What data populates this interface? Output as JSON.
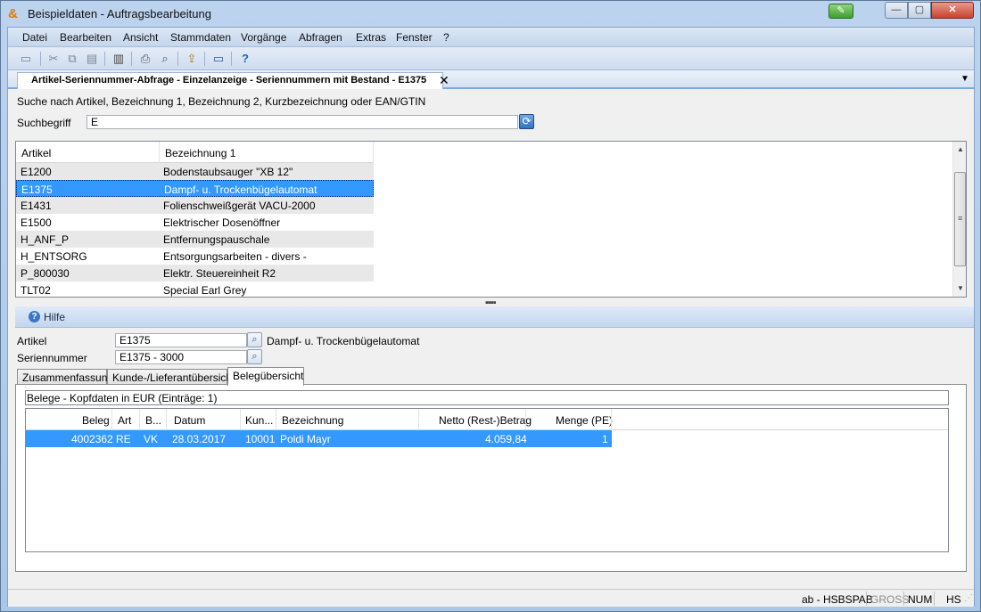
{
  "window": {
    "title": "Beispieldaten - Auftragsbearbeitung",
    "app_icon": "app-logo-icon"
  },
  "menubar": {
    "items": [
      "Datei",
      "Bearbeiten",
      "Ansicht",
      "Stammdaten",
      "Vorgänge",
      "Abfragen",
      "Extras",
      "Fenster",
      "?"
    ]
  },
  "toolbar": {
    "icons": [
      "open-folder-icon",
      "cut-icon",
      "copy-icon",
      "paste-icon",
      "list-icon",
      "print-icon",
      "print-preview-icon",
      "export-icon",
      "window-icon",
      "help-icon"
    ]
  },
  "document_tab": {
    "title": "Artikel-Seriennummer-Abfrage - Einzelanzeige - Seriennummern mit Bestand - E1375",
    "close": "✕"
  },
  "search": {
    "description": "Suche nach Artikel, Bezeichnung 1, Bezeichnung 2, Kurzbezeichnung oder EAN/GTIN",
    "label": "Suchbegriff",
    "value": "E"
  },
  "article_grid": {
    "columns": [
      "Artikel",
      "Bezeichnung 1"
    ],
    "rows": [
      {
        "artikel": "E1200",
        "bezeichnung": "Bodenstaubsauger \"XB 12\""
      },
      {
        "artikel": "E1375",
        "bezeichnung": "Dampf- u. Trockenbügelautomat"
      },
      {
        "artikel": "E1431",
        "bezeichnung": "Folienschweißgerät VACU-2000"
      },
      {
        "artikel": "E1500",
        "bezeichnung": "Elektrischer Dosenöffner"
      },
      {
        "artikel": "H_ANF_P",
        "bezeichnung": "Entfernungspauschale"
      },
      {
        "artikel": "H_ENTSORG",
        "bezeichnung": "Entsorgungsarbeiten - divers -"
      },
      {
        "artikel": "P_800030",
        "bezeichnung": "Elektr. Steuereinheit R2"
      },
      {
        "artikel": "TLT02",
        "bezeichnung": "Special Earl Grey"
      }
    ],
    "selected_index": 1
  },
  "help": {
    "label": "Hilfe"
  },
  "detail": {
    "artikel_label": "Artikel",
    "artikel_value": "E1375",
    "artikel_desc": "Dampf- u. Trockenbügelautomat",
    "serien_label": "Seriennummer",
    "serien_value": "E1375 - 3000"
  },
  "subtabs": {
    "items": [
      "Zusammenfassung",
      "Kunde-/Lieferantübersicht",
      "Belegübersicht"
    ],
    "active_index": 2
  },
  "belege": {
    "caption": "Belege - Kopfdaten in EUR (Einträge: 1)",
    "columns": [
      "Beleg",
      "Art",
      "B...",
      "Datum",
      "Kun...",
      "Bezeichnung",
      "Netto (Rest-)Betrag",
      "Menge (PE)"
    ],
    "rows": [
      {
        "beleg": "4002362",
        "art": "RE",
        "b": "VK",
        "datum": "28.03.2017",
        "kunde": "10001",
        "bezeichnung": "Poldi Mayr",
        "netto": "4.059,84",
        "menge": "1"
      }
    ]
  },
  "statusbar": {
    "user": "ab - HSBSPAB",
    "gross": "GROSS",
    "num": "NUM",
    "hs": "HS"
  },
  "colors": {
    "selection": "#3399ff",
    "title_bar": "#bcd3ee"
  }
}
